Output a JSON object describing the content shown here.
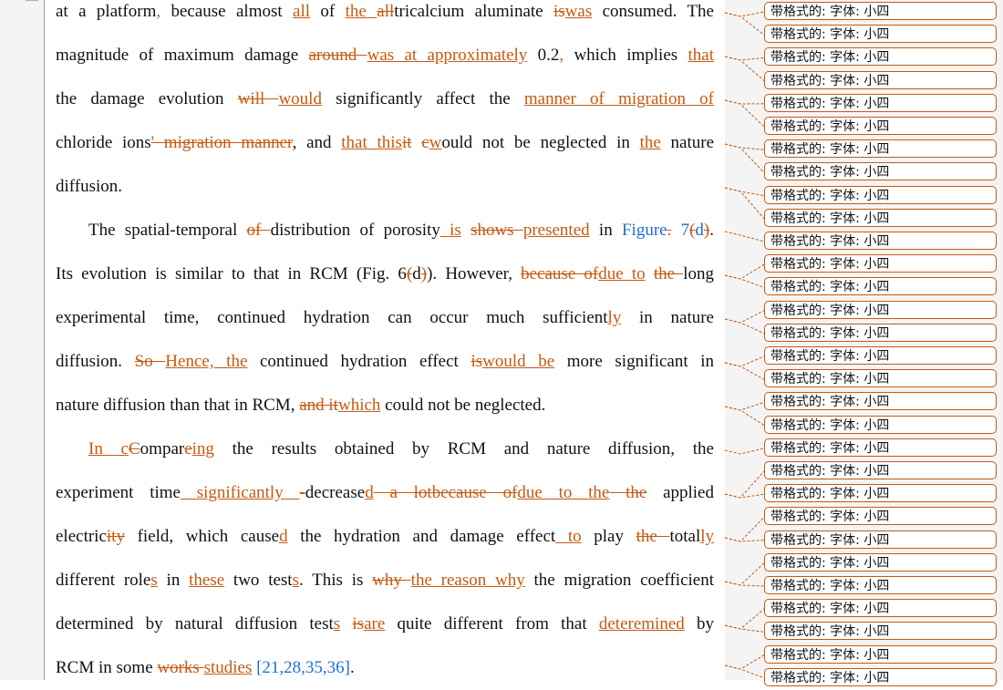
{
  "document": {
    "lines": [
      {
        "class": "justify",
        "segments": [
          {
            "t": "at a platform",
            "k": "n"
          },
          {
            "t": ",",
            "k": "ins"
          },
          {
            "t": " because almost ",
            "k": "n"
          },
          {
            "t": "all",
            "k": "ins"
          },
          {
            "t": " of ",
            "k": "n"
          },
          {
            "t": "the ",
            "k": "ins"
          },
          {
            "t": "all",
            "k": "del"
          },
          {
            "t": "tricalcium aluminate ",
            "k": "n"
          },
          {
            "t": "is",
            "k": "del"
          },
          {
            "t": "was",
            "k": "ins"
          },
          {
            "t": " consumed. The",
            "k": "n"
          }
        ]
      },
      {
        "class": "justify",
        "segments": [
          {
            "t": "magnitude of maximum damage ",
            "k": "n"
          },
          {
            "t": "around ",
            "k": "del"
          },
          {
            "t": "was at approximately",
            "k": "ins"
          },
          {
            "t": " 0.2",
            "k": "n"
          },
          {
            "t": ",",
            "k": "ins"
          },
          {
            "t": " which implies ",
            "k": "n"
          },
          {
            "t": "that",
            "k": "ins"
          }
        ]
      },
      {
        "class": "justify",
        "segments": [
          {
            "t": "the damage evolution ",
            "k": "n"
          },
          {
            "t": "will ",
            "k": "del"
          },
          {
            "t": "would",
            "k": "ins"
          },
          {
            "t": " significantly affect the ",
            "k": "n"
          },
          {
            "t": "manner of migration of",
            "k": "ins"
          }
        ]
      },
      {
        "class": "justify",
        "segments": [
          {
            "t": "chloride ions",
            "k": "n"
          },
          {
            "t": "' migration manner",
            "k": "del"
          },
          {
            "t": ", and ",
            "k": "n"
          },
          {
            "t": "that this",
            "k": "ins"
          },
          {
            "t": "it",
            "k": "del"
          },
          {
            "t": " ",
            "k": "n"
          },
          {
            "t": "c",
            "k": "del"
          },
          {
            "t": "w",
            "k": "ins"
          },
          {
            "t": "ould not be neglected in ",
            "k": "n"
          },
          {
            "t": "the",
            "k": "ins"
          },
          {
            "t": " nature",
            "k": "n"
          }
        ]
      },
      {
        "class": "left",
        "segments": [
          {
            "t": "diffusion.",
            "k": "n"
          }
        ]
      },
      {
        "class": "justify indent",
        "segments": [
          {
            "t": "The spatial-temporal ",
            "k": "n"
          },
          {
            "t": "of ",
            "k": "del"
          },
          {
            "t": "distribution of porosity",
            "k": "n"
          },
          {
            "t": " is",
            "k": "ins"
          },
          {
            "t": " ",
            "k": "n"
          },
          {
            "t": "shows ",
            "k": "del"
          },
          {
            "t": "presented",
            "k": "ins"
          },
          {
            "t": " in ",
            "k": "n"
          },
          {
            "t": "Figure",
            "k": "link"
          },
          {
            "t": ".",
            "k": "del"
          },
          {
            "t": " 7",
            "k": "link"
          },
          {
            "t": "(",
            "k": "del"
          },
          {
            "t": "d",
            "k": "link"
          },
          {
            "t": ")",
            "k": "del"
          },
          {
            "t": ".",
            "k": "n"
          }
        ]
      },
      {
        "class": "justify",
        "segments": [
          {
            "t": "Its evolution is similar to that in RCM (Fig. 6",
            "k": "n"
          },
          {
            "t": "(",
            "k": "del"
          },
          {
            "t": "d",
            "k": "n"
          },
          {
            "t": ")",
            "k": "del"
          },
          {
            "t": "). However, ",
            "k": "n"
          },
          {
            "t": "because of",
            "k": "del"
          },
          {
            "t": "due to",
            "k": "ins"
          },
          {
            "t": " ",
            "k": "n"
          },
          {
            "t": "the ",
            "k": "del"
          },
          {
            "t": "long",
            "k": "n"
          }
        ]
      },
      {
        "class": "justify",
        "segments": [
          {
            "t": "experimental time, continued hydration can occur much sufficient",
            "k": "n"
          },
          {
            "t": "ly",
            "k": "ins"
          },
          {
            "t": " in nature",
            "k": "n"
          }
        ]
      },
      {
        "class": "justify",
        "segments": [
          {
            "t": "diffusion. ",
            "k": "n"
          },
          {
            "t": "So ",
            "k": "del"
          },
          {
            "t": "Hence, the",
            "k": "ins"
          },
          {
            "t": " continued hydration effect ",
            "k": "n"
          },
          {
            "t": "is",
            "k": "del"
          },
          {
            "t": "would be",
            "k": "ins"
          },
          {
            "t": " more significant in",
            "k": "n"
          }
        ]
      },
      {
        "class": "left",
        "segments": [
          {
            "t": "nature diffusion than that in RCM, ",
            "k": "n"
          },
          {
            "t": "and it",
            "k": "del"
          },
          {
            "t": "which",
            "k": "ins"
          },
          {
            "t": " could not be neglected.",
            "k": "n"
          }
        ]
      },
      {
        "class": "justify indent",
        "segments": [
          {
            "t": "In c",
            "k": "ins"
          },
          {
            "t": "C",
            "k": "del"
          },
          {
            "t": "ompar",
            "k": "n"
          },
          {
            "t": "e",
            "k": "del"
          },
          {
            "t": "ing",
            "k": "ins"
          },
          {
            "t": " the results obtained by RCM and nature diffusion, the",
            "k": "n"
          }
        ]
      },
      {
        "class": "justify",
        "segments": [
          {
            "t": "experiment time",
            "k": "n"
          },
          {
            "t": " significantly ",
            "k": "ins"
          },
          {
            "t": "-",
            "k": "del"
          },
          {
            "t": "decrease",
            "k": "n"
          },
          {
            "t": "d",
            "k": "ins"
          },
          {
            "t": " a lot",
            "k": "del"
          },
          {
            "t": "because of",
            "k": "del"
          },
          {
            "t": "due to the",
            "k": "ins"
          },
          {
            "t": " the",
            "k": "del"
          },
          {
            "t": " applied",
            "k": "n"
          }
        ]
      },
      {
        "class": "justify",
        "segments": [
          {
            "t": "electric",
            "k": "n"
          },
          {
            "t": "ity",
            "k": "del"
          },
          {
            "t": " field, which cause",
            "k": "n"
          },
          {
            "t": "d",
            "k": "ins"
          },
          {
            "t": " the hydration and damage effect",
            "k": "n"
          },
          {
            "t": " to",
            "k": "ins"
          },
          {
            "t": " play ",
            "k": "n"
          },
          {
            "t": "the ",
            "k": "del"
          },
          {
            "t": "total",
            "k": "n"
          },
          {
            "t": "ly",
            "k": "ins"
          }
        ]
      },
      {
        "class": "justify",
        "segments": [
          {
            "t": "different role",
            "k": "n"
          },
          {
            "t": "s",
            "k": "ins"
          },
          {
            "t": " in ",
            "k": "n"
          },
          {
            "t": "these",
            "k": "ins"
          },
          {
            "t": " two test",
            "k": "n"
          },
          {
            "t": "s",
            "k": "ins"
          },
          {
            "t": ". This is ",
            "k": "n"
          },
          {
            "t": "why ",
            "k": "del"
          },
          {
            "t": "the reason why",
            "k": "ins"
          },
          {
            "t": " the migration coefficient",
            "k": "n"
          }
        ]
      },
      {
        "class": "justify",
        "segments": [
          {
            "t": "determined by natural diffusion test",
            "k": "n"
          },
          {
            "t": "s",
            "k": "ins"
          },
          {
            "t": " ",
            "k": "n"
          },
          {
            "t": "is",
            "k": "del"
          },
          {
            "t": "are",
            "k": "ins"
          },
          {
            "t": " quite different from that ",
            "k": "n"
          },
          {
            "t": "deteremined",
            "k": "ins"
          },
          {
            "t": " by",
            "k": "n"
          }
        ]
      },
      {
        "class": "left",
        "segments": [
          {
            "t": "RCM in some ",
            "k": "n"
          },
          {
            "t": "works ",
            "k": "del"
          },
          {
            "t": "studies",
            "k": "ins"
          },
          {
            "t": " ",
            "k": "n"
          },
          {
            "t": "[21,28,35,36]",
            "k": "link"
          },
          {
            "t": ".",
            "k": "n"
          }
        ]
      }
    ]
  },
  "comments": {
    "label": "带格式的: 字体: 小四",
    "items": [
      "带格式的: 字体: 小四",
      "带格式的: 字体: 小四",
      "带格式的: 字体: 小四",
      "带格式的: 字体: 小四",
      "带格式的: 字体: 小四",
      "带格式的: 字体: 小四",
      "带格式的: 字体: 小四",
      "带格式的: 字体: 小四",
      "带格式的: 字体: 小四",
      "带格式的: 字体: 小四",
      "带格式的: 字体: 小四",
      "带格式的: 字体: 小四",
      "带格式的: 字体: 小四",
      "带格式的: 字体: 小四",
      "带格式的: 字体: 小四",
      "带格式的: 字体: 小四",
      "带格式的: 字体: 小四",
      "带格式的: 字体: 小四",
      "带格式的: 字体: 小四",
      "带格式的: 字体: 小四",
      "带格式的: 字体: 小四",
      "带格式的: 字体: 小四",
      "带格式的: 字体: 小四",
      "带格式的: 字体: 小四",
      "带格式的: 字体: 小四",
      "带格式的: 字体: 小四",
      "带格式的: 字体: 小四",
      "带格式的: 字体: 小四",
      "带格式的: 字体: 小四",
      "带格式的: 字体: 小四"
    ]
  },
  "colors": {
    "revision": "#c55a11",
    "link": "#1f6fd0",
    "text": "#111111",
    "margin_bg": "#f4f4f4"
  }
}
